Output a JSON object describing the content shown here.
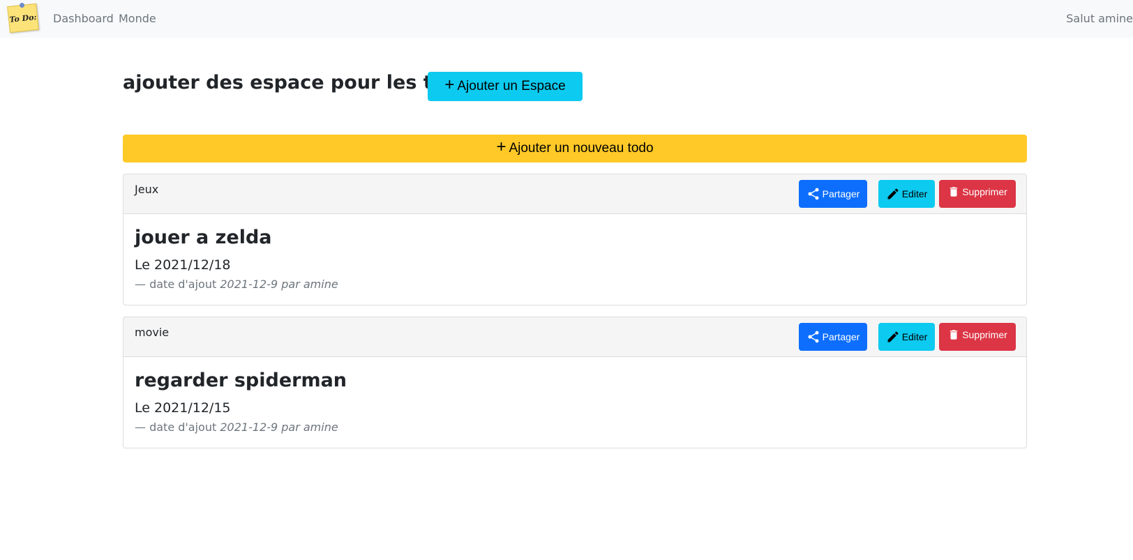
{
  "nav": {
    "logo_text": "To Do:",
    "links": [
      "Dashboard",
      "Monde"
    ],
    "user_greeting": "Salut amine"
  },
  "header": {
    "title": "ajouter des espace pour les todo",
    "add_space_label": "Ajouter un Espace",
    "add_space_icon": "+"
  },
  "add_todo": {
    "label": "Ajouter un nouveau todo",
    "icon": "+"
  },
  "actions": {
    "share_label": "Partager",
    "edit_label": "Editer",
    "delete_label": "Supprimer"
  },
  "todos": [
    {
      "category": "Jeux",
      "title": "jouer a zelda",
      "date": "Le 2021/12/18",
      "meta_prefix": "— date d'ajout",
      "meta_detail": "2021-12-9 par amine"
    },
    {
      "category": "movie",
      "title": "regarder spiderman",
      "date": "Le 2021/12/15",
      "meta_prefix": "— date d'ajout",
      "meta_detail": "2021-12-9 par amine"
    }
  ],
  "colors": {
    "navbar_bg": "#f8f9fa",
    "info": "#0dcaf0",
    "warning": "#ffc928",
    "primary": "#0d6efd",
    "danger": "#dc3545"
  }
}
